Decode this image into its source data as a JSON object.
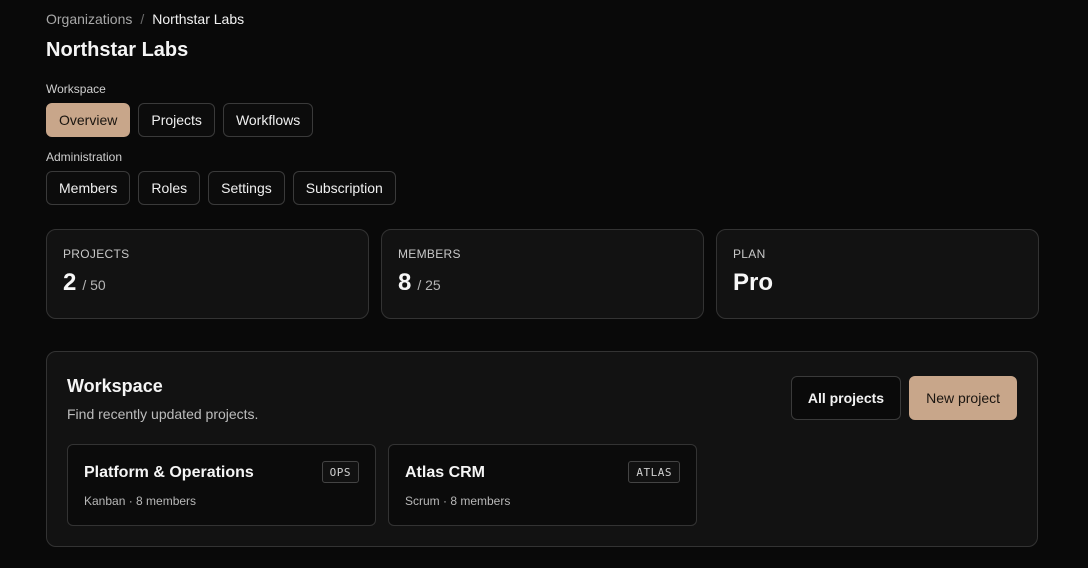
{
  "breadcrumb": {
    "parent": "Organizations",
    "separator": "/",
    "current": "Northstar Labs"
  },
  "page_title": "Northstar Labs",
  "workspace_nav": {
    "label": "Workspace",
    "items": [
      {
        "label": "Overview",
        "active": true
      },
      {
        "label": "Projects",
        "active": false
      },
      {
        "label": "Workflows",
        "active": false
      }
    ]
  },
  "admin_nav": {
    "label": "Administration",
    "items": [
      {
        "label": "Members"
      },
      {
        "label": "Roles"
      },
      {
        "label": "Settings"
      },
      {
        "label": "Subscription"
      }
    ]
  },
  "stats": [
    {
      "label": "PROJECTS",
      "value": "2",
      "limit": "/ 50"
    },
    {
      "label": "MEMBERS",
      "value": "8",
      "limit": "/ 25"
    },
    {
      "label": "PLAN",
      "value": "Pro",
      "limit": ""
    }
  ],
  "workspace_panel": {
    "title": "Workspace",
    "subtitle": "Find recently updated projects.",
    "all_projects_label": "All projects",
    "new_project_label": "New project",
    "projects": [
      {
        "name": "Platform & Operations",
        "meta": "Kanban · 8 members",
        "tag": "OPS"
      },
      {
        "name": "Atlas CRM",
        "meta": "Scrum · 8 members",
        "tag": "ATLAS"
      }
    ]
  },
  "colors": {
    "background": "#090909",
    "accent": "#c8a68a",
    "card": "#121212",
    "border": "#333333"
  }
}
